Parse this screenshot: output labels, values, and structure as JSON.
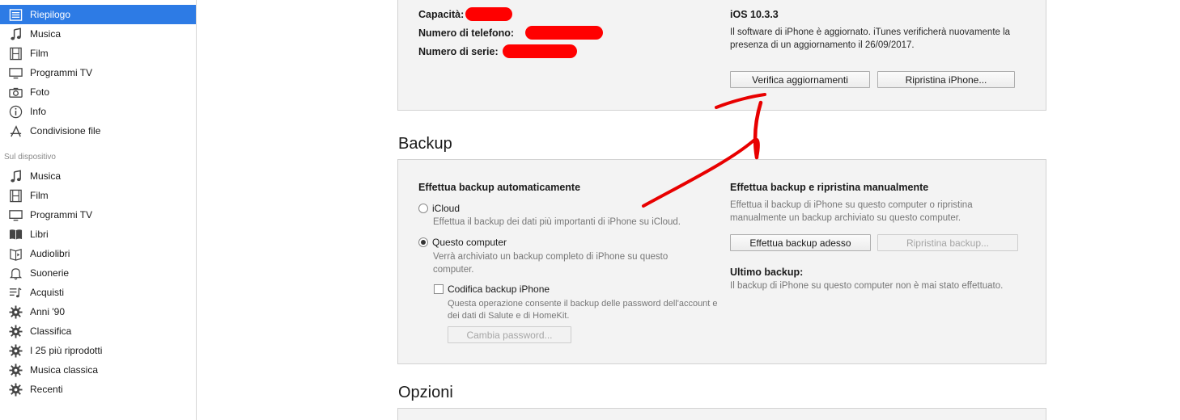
{
  "sidebar": {
    "settings_items": [
      {
        "label": "Riepilogo",
        "icon": "summary-icon",
        "selected": true
      },
      {
        "label": "Musica",
        "icon": "music-note-icon"
      },
      {
        "label": "Film",
        "icon": "film-strip-icon"
      },
      {
        "label": "Programmi TV",
        "icon": "tv-icon"
      },
      {
        "label": "Foto",
        "icon": "camera-icon"
      },
      {
        "label": "Info",
        "icon": "info-icon"
      },
      {
        "label": "Condivisione file",
        "icon": "app-store-icon"
      }
    ],
    "device_header": "Sul dispositivo",
    "device_items": [
      {
        "label": "Musica",
        "icon": "music-note-icon"
      },
      {
        "label": "Film",
        "icon": "film-strip-icon"
      },
      {
        "label": "Programmi TV",
        "icon": "tv-icon"
      },
      {
        "label": "Libri",
        "icon": "book-icon"
      },
      {
        "label": "Audiolibri",
        "icon": "audiobook-icon"
      },
      {
        "label": "Suonerie",
        "icon": "bell-icon"
      },
      {
        "label": "Acquisti",
        "icon": "purchased-list-icon"
      },
      {
        "label": "Anni '90",
        "icon": "gear-icon"
      },
      {
        "label": "Classifica",
        "icon": "gear-icon"
      },
      {
        "label": "I 25 più riprodotti",
        "icon": "gear-icon"
      },
      {
        "label": "Musica classica",
        "icon": "gear-icon"
      },
      {
        "label": "Recenti",
        "icon": "gear-icon"
      }
    ]
  },
  "device_info": {
    "capacity_label": "Capacità:",
    "phone_label": "Numero di telefono:",
    "serial_label": "Numero di serie:"
  },
  "software": {
    "version": "iOS 10.3.3",
    "status_line1": "Il software di iPhone è aggiornato. iTunes verificherà nuovamente la",
    "status_line2": "presenza di un aggiornamento il 26/09/2017.",
    "check_button": "Verifica aggiornamenti",
    "restore_button": "Ripristina iPhone..."
  },
  "backup": {
    "title": "Backup",
    "auto_heading": "Effettua backup automaticamente",
    "icloud_label": "iCloud",
    "icloud_desc": "Effettua il backup dei dati più importanti di iPhone su iCloud.",
    "computer_label": "Questo computer",
    "computer_desc1": "Verrà archiviato un backup completo di iPhone su questo",
    "computer_desc2": "computer.",
    "encrypt_label": "Codifica backup iPhone",
    "encrypt_desc1": "Questa operazione consente il backup delle password dell'account e",
    "encrypt_desc2": "dei dati di Salute e di HomeKit.",
    "change_password_button": "Cambia password...",
    "manual_heading": "Effettua backup e ripristina manualmente",
    "manual_desc1": "Effettua il backup di iPhone su questo computer o ripristina",
    "manual_desc2": "manualmente un backup archiviato su questo computer.",
    "backup_now_button": "Effettua backup adesso",
    "restore_backup_button": "Ripristina backup...",
    "last_backup_heading": "Ultimo backup:",
    "last_backup_desc": "Il backup di iPhone su questo computer non è mai stato effettuato."
  },
  "options": {
    "title": "Opzioni"
  },
  "colors": {
    "selection": "#2d7be5",
    "redaction": "#ff0000",
    "panel_bg": "#f3f3f3"
  }
}
